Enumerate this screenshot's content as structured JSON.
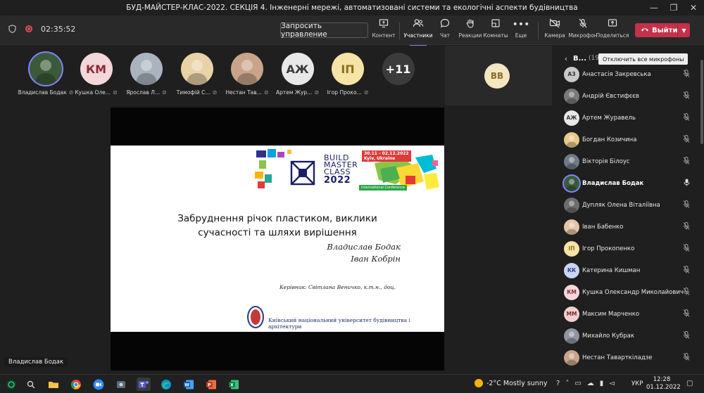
{
  "window": {
    "title": "БУД-МАЙСТЕР-КЛАС-2022. СЕКЦІЯ 4. Інженерні мережі, автоматизовані системи та екологічні аспекти будівництва"
  },
  "toolbar": {
    "timer": "02:35:52",
    "request_control": "Запросить управление",
    "buttons": {
      "content": "Контент",
      "participants": "Участники",
      "chat": "Чат",
      "reactions": "Реакции",
      "rooms": "Комнаты",
      "more": "Еще",
      "camera": "Камера",
      "mic": "Микрофон",
      "share": "Поделиться",
      "leave": "Выйти"
    }
  },
  "strip": {
    "tiles": [
      {
        "name": "Владислав Бодак",
        "initials": "",
        "bg": "#3b5a3a",
        "photo": true
      },
      {
        "name": "Кушка Оле...",
        "initials": "КМ",
        "bg": "#f4d7d8",
        "fg": "#8a2b3a"
      },
      {
        "name": "Ярослав Л...",
        "initials": "",
        "bg": "#aab4bf",
        "photo": true
      },
      {
        "name": "Тимофій С...",
        "initials": "",
        "bg": "#e8d2a6",
        "photo": true
      },
      {
        "name": "Нестан Тав...",
        "initials": "",
        "bg": "#c9a48a",
        "photo": true
      },
      {
        "name": "Артем Жур...",
        "initials": "АЖ",
        "bg": "#e8e8e8",
        "fg": "#3a3a3a"
      },
      {
        "name": "Ігор Проко...",
        "initials": "ІП",
        "bg": "#f6e3a6",
        "fg": "#8a6d1e"
      },
      {
        "name": "",
        "initials": "+11",
        "bg": "#3b3b3b",
        "fg": "#ffffff"
      }
    ],
    "right_tile_initials": "ВВ"
  },
  "slide": {
    "logo": {
      "line1": "BUILD",
      "line2": "MASTER",
      "line3": "CLASS",
      "year": "2022",
      "dates": "30.11 - 02.12.2022",
      "city": "Kyiv, Ukraine",
      "conference": "International Conference"
    },
    "title_line1": "Забруднення річок пластиком, виклики",
    "title_line2": "сучасності та шляхи вирішення",
    "author1": "Владислав Бодак",
    "author2": "Іван Кобрін",
    "supervisor": "Керівник: Світлана Веничко, к.т.н., доц.",
    "university": "Київський національний університет будівництва і архітектури"
  },
  "self_label": "Владислав Бодак",
  "sidebar": {
    "title": "В...",
    "count": "(19)",
    "mute_all": "Отключить все микрофоны",
    "participants": [
      {
        "name": "Анастасія Закревська",
        "initials": "АЗ",
        "bg": "#c9c9c9",
        "fg": "#333"
      },
      {
        "name": "Андрій Євстифєєв",
        "initials": "",
        "bg": "#7a7a7a",
        "photo": true
      },
      {
        "name": "Артем Журавель",
        "initials": "АЖ",
        "bg": "#e8e8e8",
        "fg": "#3a3a3a"
      },
      {
        "name": "Богдан Козичина",
        "initials": "",
        "bg": "#e8c98a",
        "photo": true
      },
      {
        "name": "Вікторія Білоус",
        "initials": "",
        "bg": "#6f7b85",
        "photo": true
      },
      {
        "name": "Владислав Бодак",
        "initials": "",
        "bg": "#3b5a3a",
        "photo": true,
        "active": true
      },
      {
        "name": "Дупляк Олена Віталіївна",
        "initials": "",
        "bg": "#6d6d6d",
        "photo": true
      },
      {
        "name": "Іван Бабенко",
        "initials": "",
        "bg": "#e6c4a8",
        "photo": true
      },
      {
        "name": "Ігор Прокопенко",
        "initials": "ІП",
        "bg": "#f6e3a6",
        "fg": "#8a6d1e"
      },
      {
        "name": "Катерина Кишман",
        "initials": "КК",
        "bg": "#c9d6f2",
        "fg": "#2b3f86"
      },
      {
        "name": "Кушка Олександр Миколайович",
        "initials": "КМ",
        "bg": "#f4d7d8",
        "fg": "#8a2b3a"
      },
      {
        "name": "Максим Марченко",
        "initials": "ММ",
        "bg": "#f0d0cf",
        "fg": "#7a2a2a"
      },
      {
        "name": "Михайло Кубрак",
        "initials": "",
        "bg": "#8e96a0",
        "photo": true
      },
      {
        "name": "Нестан Таварткіладзе",
        "initials": "",
        "bg": "#c9a48a",
        "photo": true
      }
    ]
  },
  "taskbar": {
    "weather": "-2°C  Mostly sunny",
    "lang": "УКР",
    "time": "12:28",
    "date": "01.12.2022"
  }
}
